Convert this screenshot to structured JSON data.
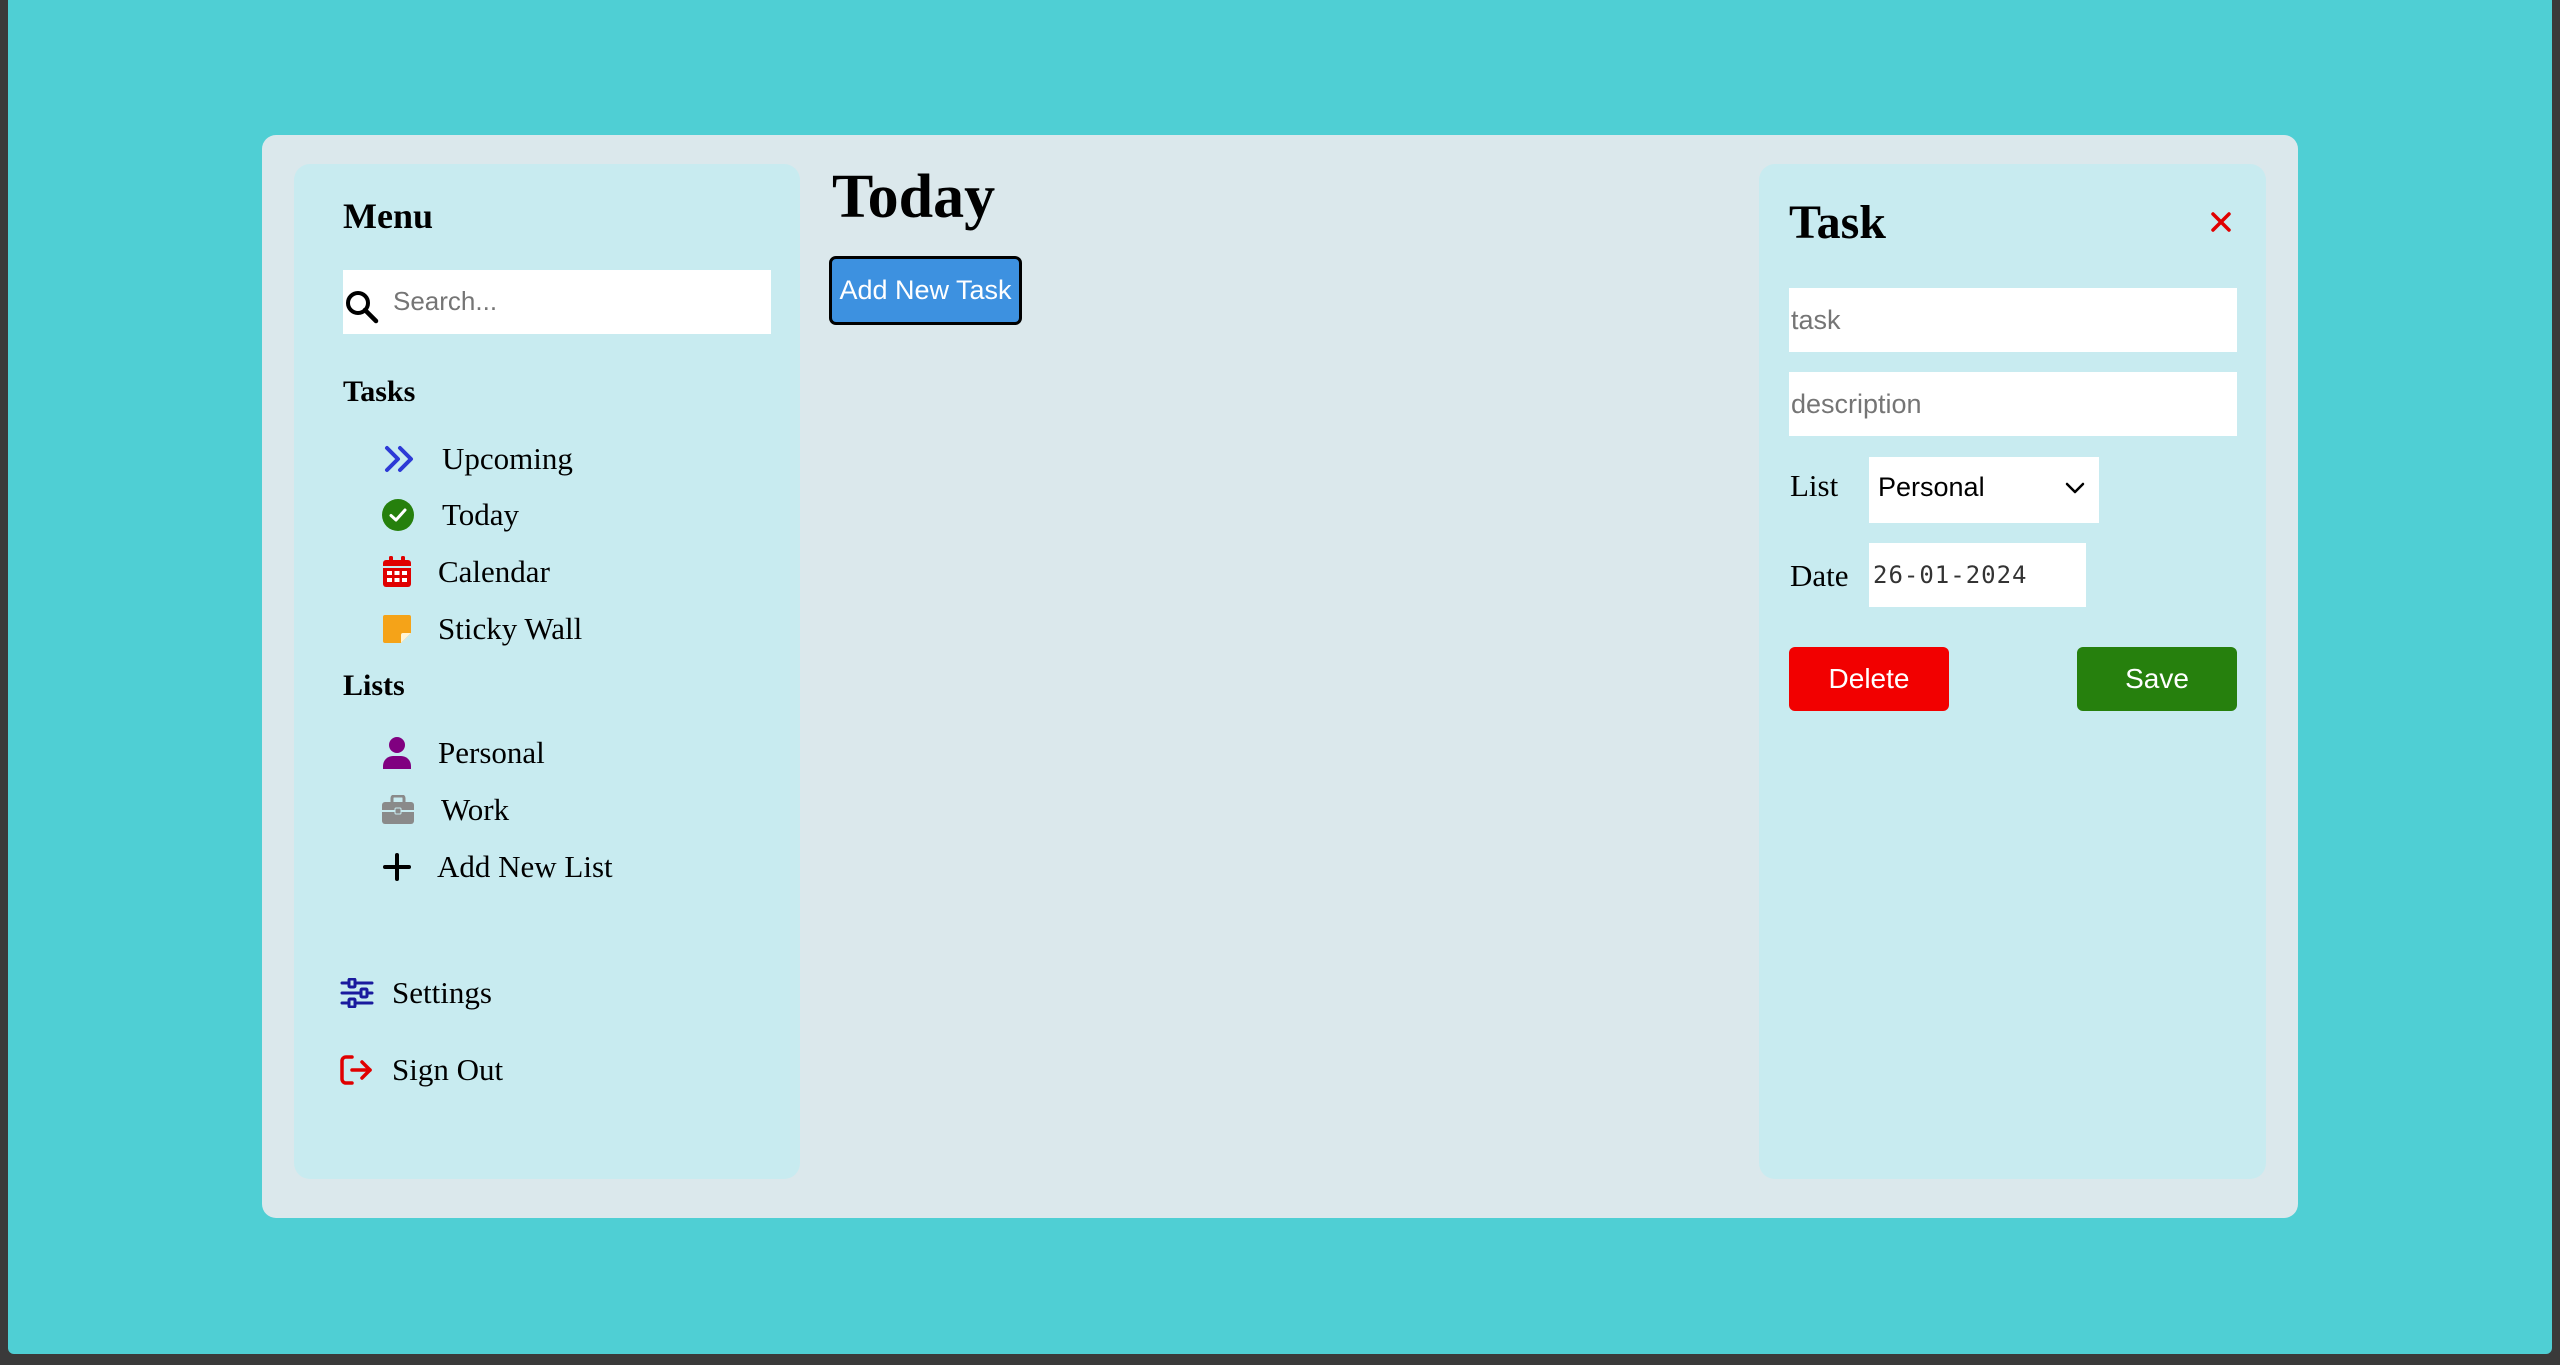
{
  "sidebar": {
    "title": "Menu",
    "search_placeholder": "Search...",
    "tasks_heading": "Tasks",
    "task_items": [
      {
        "label": "Upcoming",
        "icon": "double-chevron-right-icon"
      },
      {
        "label": "Today",
        "icon": "check-circle-icon"
      },
      {
        "label": "Calendar",
        "icon": "calendar-icon"
      },
      {
        "label": "Sticky Wall",
        "icon": "sticky-note-icon"
      }
    ],
    "lists_heading": "Lists",
    "list_items": [
      {
        "label": "Personal",
        "icon": "user-icon"
      },
      {
        "label": "Work",
        "icon": "briefcase-icon"
      },
      {
        "label": "Add New List",
        "icon": "plus-icon"
      }
    ],
    "settings_label": "Settings",
    "signout_label": "Sign Out"
  },
  "main": {
    "title": "Today",
    "add_task_label": "Add New Task"
  },
  "task_panel": {
    "title": "Task",
    "task_placeholder": "task",
    "description_placeholder": "description",
    "list_label": "List",
    "list_value": "Personal",
    "date_label": "Date",
    "date_value": "26-01-2024",
    "delete_label": "Delete",
    "save_label": "Save"
  },
  "colors": {
    "page_background": "#4fcfd4",
    "app_background": "#dbe8ec",
    "panel_background": "#c8ebf0",
    "add_task_button": "#3d91e0",
    "delete_button": "#f20000",
    "save_button": "#26800d",
    "upcoming_icon": "#2d3ad6",
    "today_icon": "#26800d",
    "calendar_icon": "#e00000",
    "sticky_icon": "#f5a318",
    "personal_icon": "#800080",
    "work_icon": "#8a8a8a",
    "settings_icon": "#1a1a9e",
    "signout_icon": "#e00000"
  }
}
